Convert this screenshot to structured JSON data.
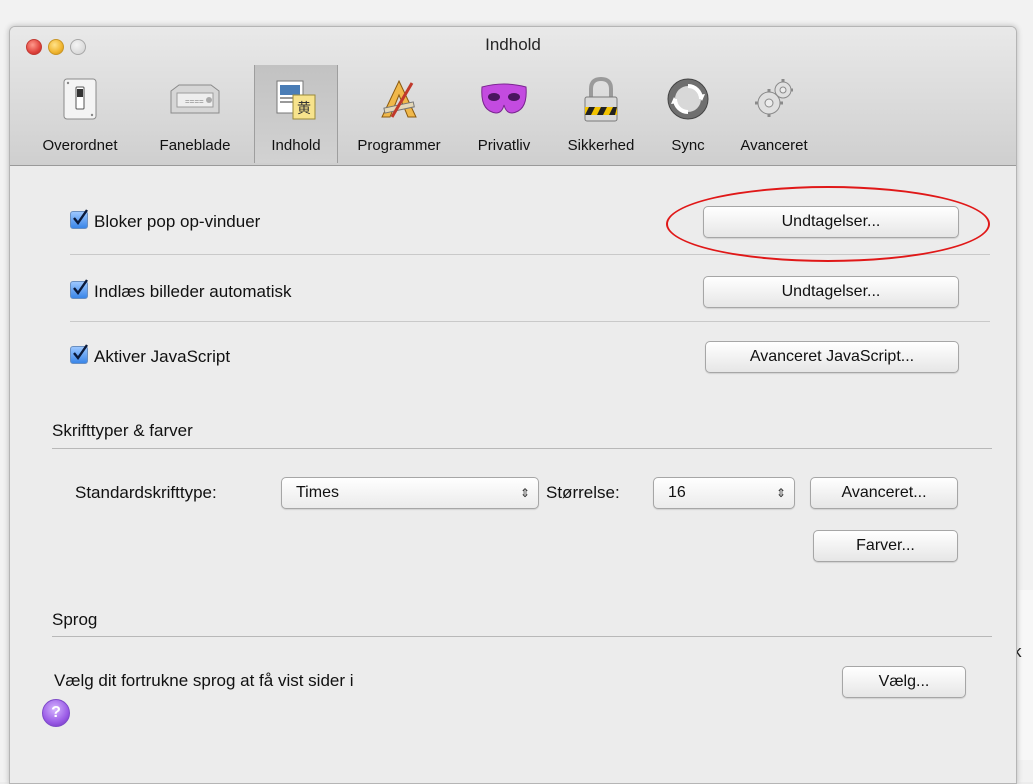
{
  "window": {
    "title": "Indhold"
  },
  "toolbar": {
    "items": [
      {
        "label": "Overordnet",
        "icon": "switch-icon"
      },
      {
        "label": "Faneblade",
        "icon": "tabs-icon"
      },
      {
        "label": "Indhold",
        "icon": "content-icon",
        "selected": true
      },
      {
        "label": "Programmer",
        "icon": "applications-icon"
      },
      {
        "label": "Privatliv",
        "icon": "mask-icon"
      },
      {
        "label": "Sikkerhed",
        "icon": "padlock-icon"
      },
      {
        "label": "Sync",
        "icon": "sync-icon"
      },
      {
        "label": "Avanceret",
        "icon": "gear-icon"
      }
    ]
  },
  "content": {
    "popups": {
      "label": "Bloker pop op-vinduer",
      "checked": true,
      "button": "Undtagelser..."
    },
    "images": {
      "label": "Indlæs billeder automatisk",
      "checked": true,
      "button": "Undtagelser..."
    },
    "javascript": {
      "label": "Aktiver JavaScript",
      "checked": true,
      "button": "Avanceret JavaScript..."
    }
  },
  "fonts": {
    "heading": "Skrifttyper & farver",
    "default_font_label": "Standardskrifttype:",
    "default_font_value": "Times",
    "size_label": "Størrelse:",
    "size_value": "16",
    "advanced_button": "Avanceret...",
    "colors_button": "Farver..."
  },
  "language": {
    "heading": "Sprog",
    "description": "Vælg dit fortrukne sprog at få vist sider i",
    "choose_button": "Vælg..."
  },
  "help": {
    "glyph": "?"
  },
  "background_window": {
    "fragment": "k"
  },
  "colors": {
    "accent": "#3a86e8",
    "highlight_ellipse": "#e01818"
  }
}
